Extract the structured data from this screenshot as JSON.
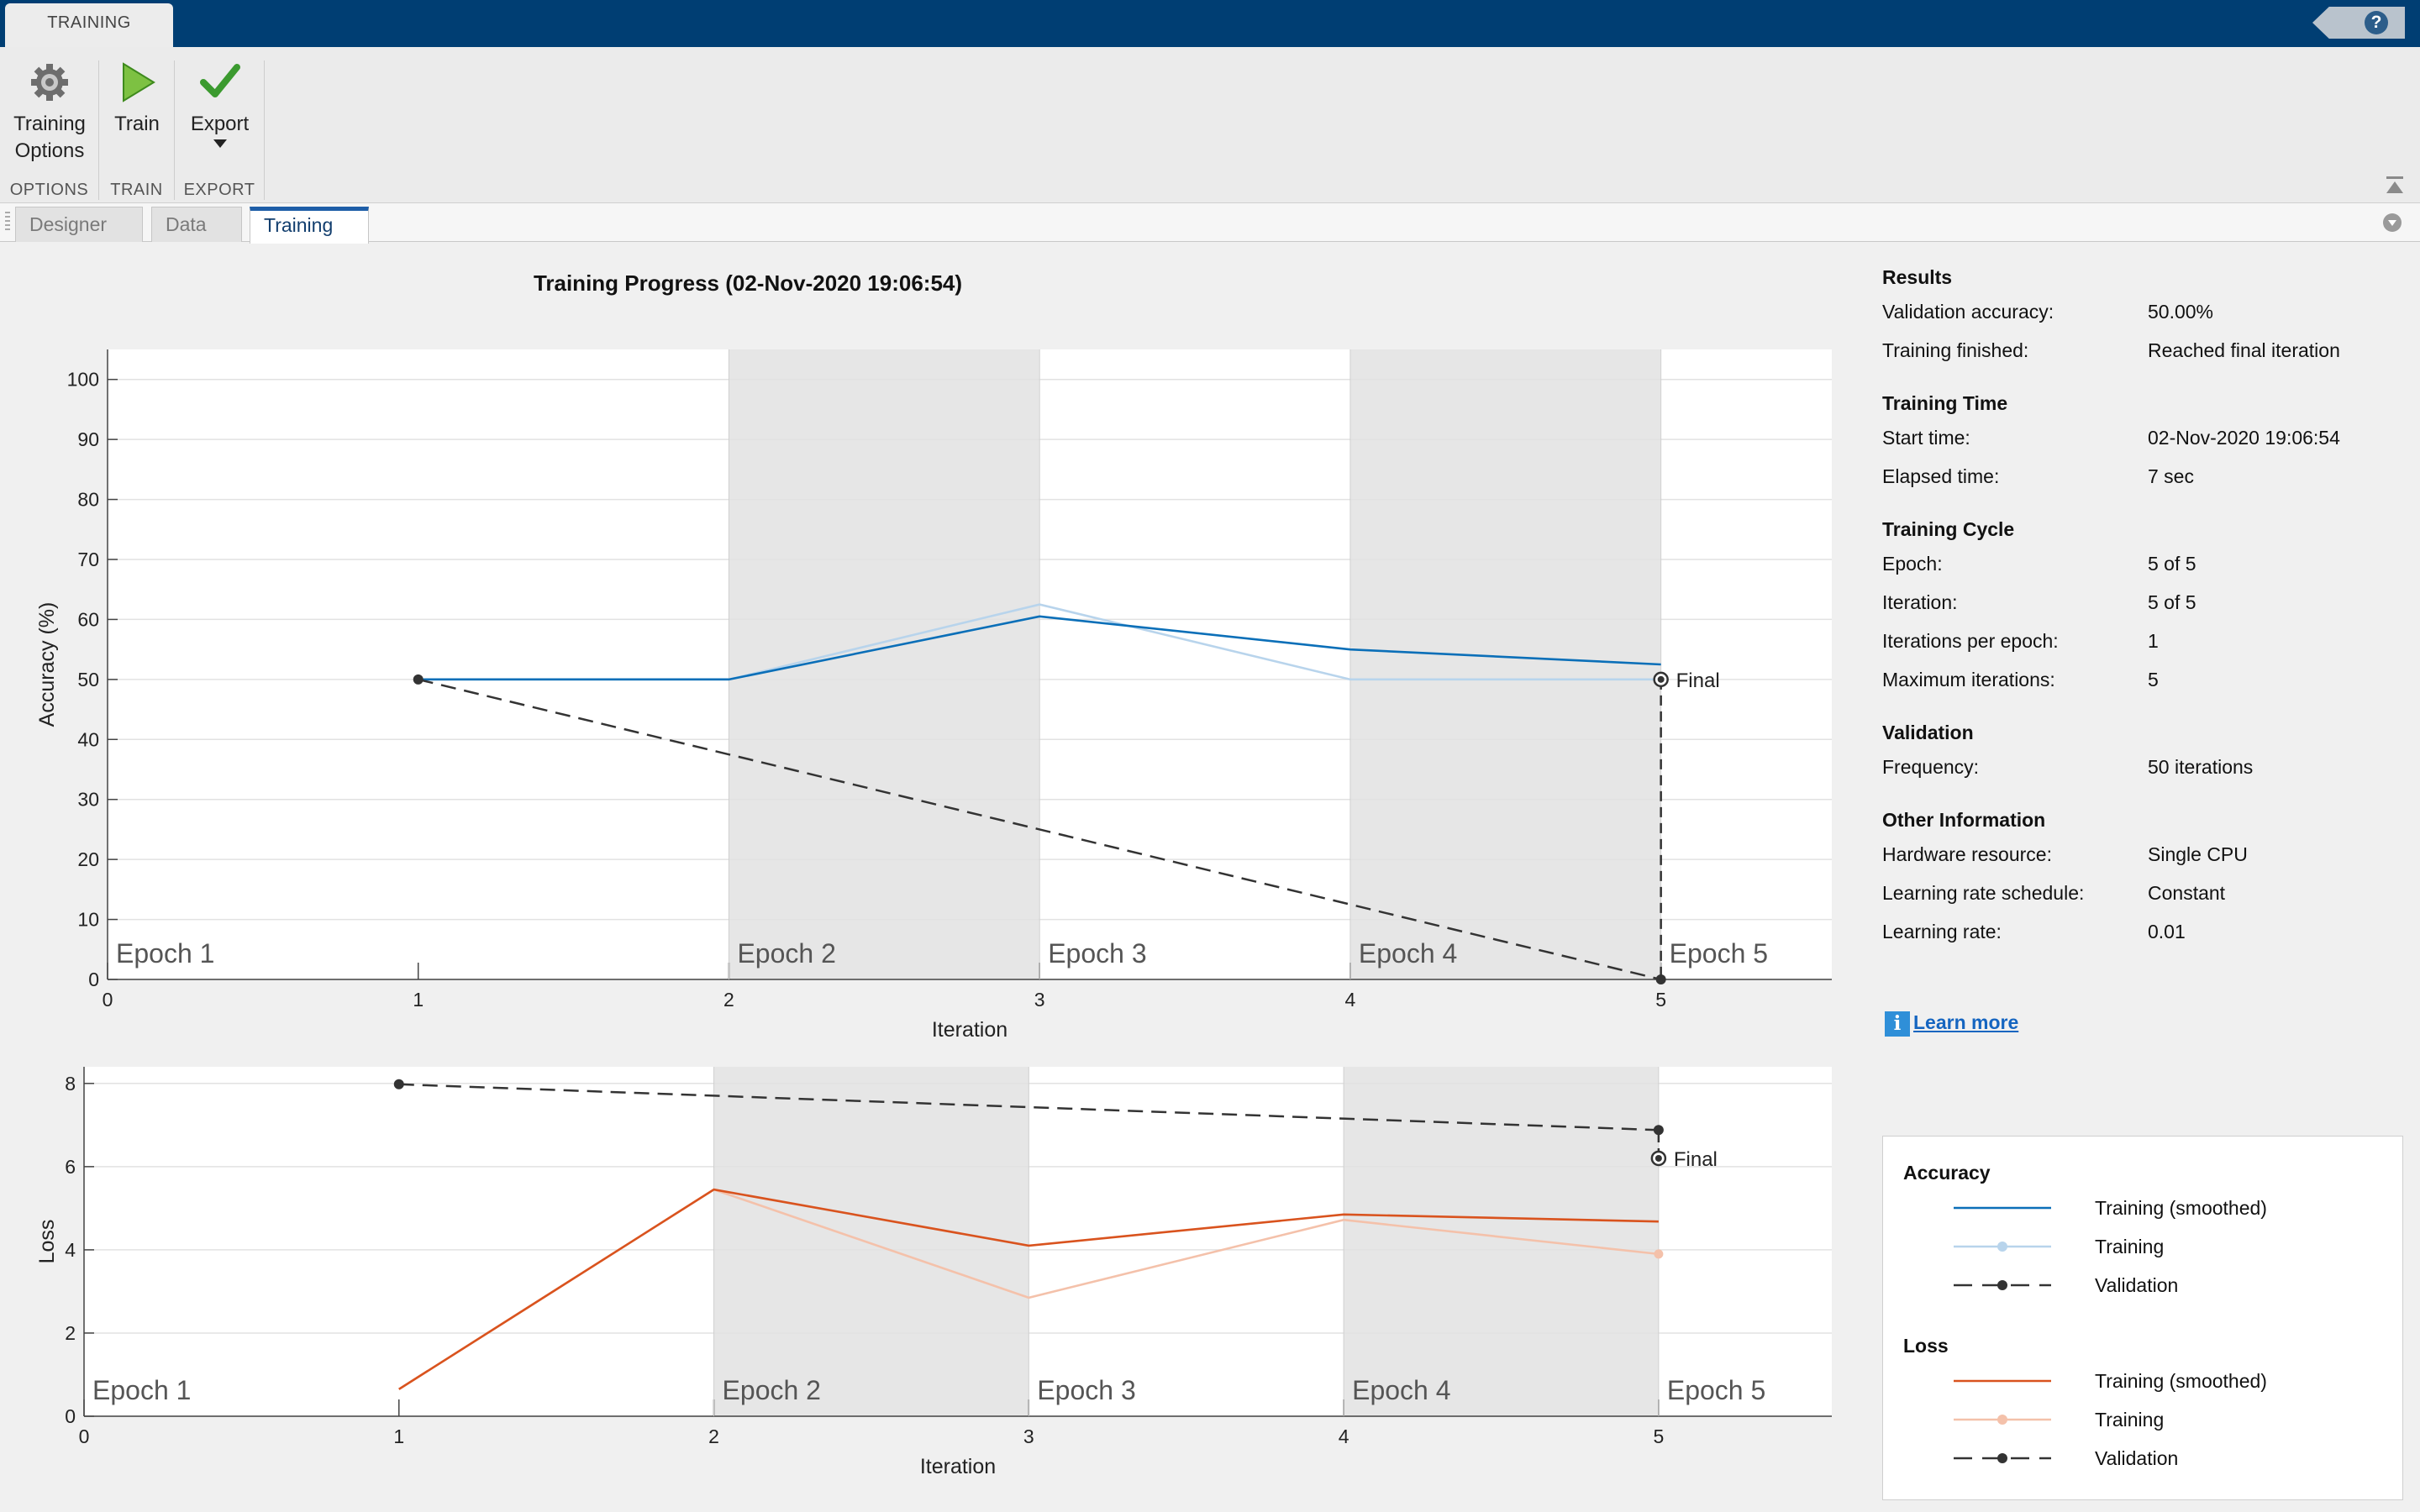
{
  "window": {
    "tab_label": "TRAINING",
    "help_label": "?"
  },
  "toolstrip": {
    "groups": [
      {
        "label": "OPTIONS",
        "buttons": [
          {
            "line1": "Training",
            "line2": "Options"
          }
        ]
      },
      {
        "label": "TRAIN",
        "buttons": [
          {
            "line1": "Train"
          }
        ]
      },
      {
        "label": "EXPORT",
        "buttons": [
          {
            "line1": "Export"
          }
        ]
      }
    ]
  },
  "doc_tabs": [
    "Designer",
    "Data",
    "Training"
  ],
  "active_doc_tab": "Training",
  "plot_title": "Training Progress (02-Nov-2020 19:06:54)",
  "chart_data": [
    {
      "type": "line",
      "title": "Training Progress (02-Nov-2020 19:06:54)",
      "xlabel": "Iteration",
      "ylabel": "Accuracy (%)",
      "xlim": [
        0,
        5.55
      ],
      "ylim": [
        0,
        105
      ],
      "xticks": [
        0,
        1,
        2,
        3,
        4,
        5
      ],
      "yticks": [
        0,
        10,
        20,
        30,
        40,
        50,
        60,
        70,
        80,
        90,
        100
      ],
      "epochs": [
        {
          "label": "Epoch 1",
          "start": 0,
          "end": 2,
          "shaded": false
        },
        {
          "label": "Epoch 2",
          "start": 2,
          "end": 3,
          "shaded": true
        },
        {
          "label": "Epoch 3",
          "start": 3,
          "end": 4,
          "shaded": false
        },
        {
          "label": "Epoch 4",
          "start": 4,
          "end": 5,
          "shaded": true
        },
        {
          "label": "Epoch 5",
          "start": 5,
          "end": 5.55,
          "shaded": false
        }
      ],
      "series": [
        {
          "name": "Training (smoothed)",
          "color": "#0b6fb8",
          "x": [
            1,
            2,
            3,
            4,
            5
          ],
          "y": [
            50,
            50,
            60.5,
            55,
            52.5
          ]
        },
        {
          "name": "Training",
          "color": "#b8d4ec",
          "x": [
            1,
            2,
            3,
            4,
            5
          ],
          "y": [
            50,
            50,
            62.5,
            50,
            50
          ]
        },
        {
          "name": "Validation",
          "color": "#333333",
          "x": [
            1,
            5
          ],
          "y": [
            50,
            0
          ],
          "dashed": true
        }
      ],
      "final": {
        "label": "Final",
        "x": 5,
        "y": 50
      }
    },
    {
      "type": "line",
      "xlabel": "Iteration",
      "ylabel": "Loss",
      "xlim": [
        0,
        5.55
      ],
      "ylim": [
        0,
        8.4
      ],
      "xticks": [
        0,
        1,
        2,
        3,
        4,
        5
      ],
      "yticks": [
        0,
        2,
        4,
        6,
        8
      ],
      "epochs": [
        {
          "label": "Epoch 1",
          "start": 0,
          "end": 2,
          "shaded": false
        },
        {
          "label": "Epoch 2",
          "start": 2,
          "end": 3,
          "shaded": true
        },
        {
          "label": "Epoch 3",
          "start": 3,
          "end": 4,
          "shaded": false
        },
        {
          "label": "Epoch 4",
          "start": 4,
          "end": 5,
          "shaded": true
        },
        {
          "label": "Epoch 5",
          "start": 5,
          "end": 5.55,
          "shaded": false
        }
      ],
      "series": [
        {
          "name": "Training (smoothed)",
          "color": "#d9531e",
          "x": [
            1,
            2,
            3,
            4,
            5
          ],
          "y": [
            0.65,
            5.45,
            4.1,
            4.85,
            4.68
          ]
        },
        {
          "name": "Training",
          "color": "#f4c1aa",
          "x": [
            1,
            2,
            3,
            4,
            5
          ],
          "y": [
            0.65,
            5.45,
            2.85,
            4.72,
            3.9
          ]
        },
        {
          "name": "Validation",
          "color": "#333333",
          "x": [
            1,
            5
          ],
          "y": [
            7.98,
            6.88
          ],
          "dashed": true
        }
      ],
      "final": {
        "label": "Final",
        "x": 5,
        "y": 6.2
      }
    }
  ],
  "results": [
    {
      "title": "Results",
      "rows": [
        {
          "key": "Validation accuracy:",
          "value": "50.00%"
        },
        {
          "key": "Training finished:",
          "value": "Reached final iteration"
        }
      ]
    },
    {
      "title": "Training Time",
      "rows": [
        {
          "key": "Start time:",
          "value": "02-Nov-2020 19:06:54"
        },
        {
          "key": "Elapsed time:",
          "value": "7 sec"
        }
      ]
    },
    {
      "title": "Training Cycle",
      "rows": [
        {
          "key": "Epoch:",
          "value": "5 of 5"
        },
        {
          "key": "Iteration:",
          "value": "5 of 5"
        },
        {
          "key": "Iterations per epoch:",
          "value": "1"
        },
        {
          "key": "Maximum iterations:",
          "value": "5"
        }
      ]
    },
    {
      "title": "Validation",
      "rows": [
        {
          "key": "Frequency:",
          "value": "50 iterations"
        }
      ]
    },
    {
      "title": "Other Information",
      "rows": [
        {
          "key": "Hardware resource:",
          "value": "Single CPU"
        },
        {
          "key": "Learning rate schedule:",
          "value": "Constant"
        },
        {
          "key": "Learning rate:",
          "value": "0.01"
        }
      ]
    }
  ],
  "learn_more": {
    "icon": "i",
    "label": "Learn more"
  },
  "legend": {
    "groups": [
      {
        "title": "Accuracy",
        "items": [
          {
            "label": "Training (smoothed)",
            "color": "#0b6fb8",
            "style": "solid"
          },
          {
            "label": "Training",
            "color": "#b8d4ec",
            "style": "marker"
          },
          {
            "label": "Validation",
            "color": "#333333",
            "style": "dashed-marker"
          }
        ]
      },
      {
        "title": "Loss",
        "items": [
          {
            "label": "Training (smoothed)",
            "color": "#d9531e",
            "style": "solid"
          },
          {
            "label": "Training",
            "color": "#f4c1aa",
            "style": "marker"
          },
          {
            "label": "Validation",
            "color": "#333333",
            "style": "dashed-marker"
          }
        ]
      }
    ]
  }
}
